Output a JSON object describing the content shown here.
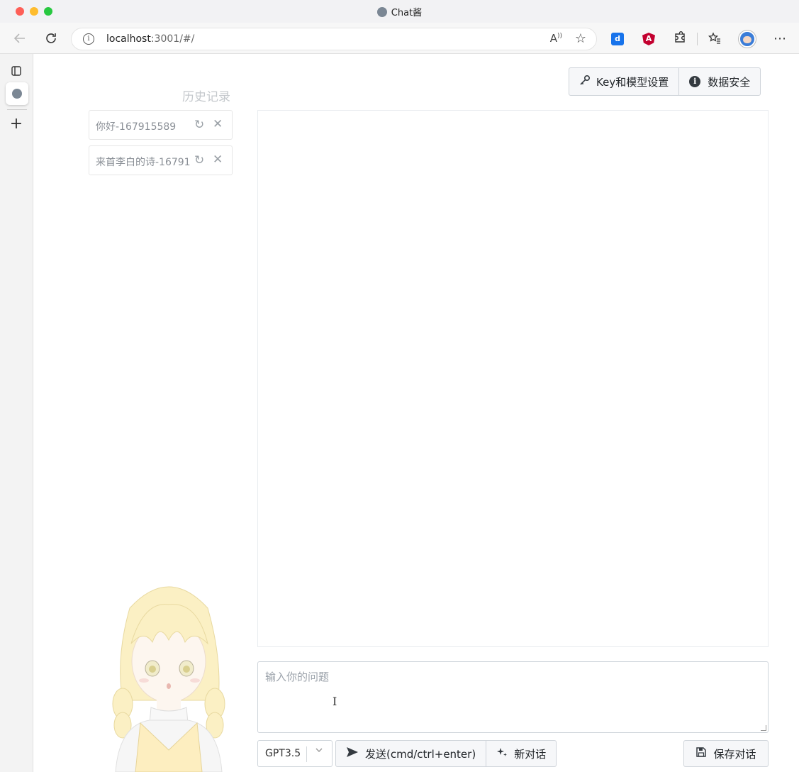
{
  "window": {
    "title": "Chat酱"
  },
  "browser": {
    "url_host": "localhost",
    "url_rest": ":3001/#/",
    "read_aloud_label": "A"
  },
  "sidebar": {
    "title": "历史记录",
    "items": [
      {
        "label": "你好-167915589"
      },
      {
        "label": "来首李白的诗-16791"
      }
    ]
  },
  "header": {
    "key_settings_label": "Key和模型设置",
    "data_security_label": "数据安全"
  },
  "input": {
    "placeholder": "输入你的问题"
  },
  "footer": {
    "model_value": "GPT3.5",
    "send_label": "发送(cmd/ctrl+enter)",
    "new_chat_label": "新对话",
    "save_label": "保存对话"
  },
  "icons": {
    "back": "arrow-left-icon",
    "refresh": "refresh-icon",
    "info": "info-icon",
    "key": "key-icon",
    "send": "send-icon",
    "sparkle": "sparkle-icon",
    "save": "floppy-disk-icon"
  },
  "colors": {
    "accent_fav": "#7b8794",
    "muted_text": "#8a8f96",
    "button_bg": "#f6f7f9"
  }
}
